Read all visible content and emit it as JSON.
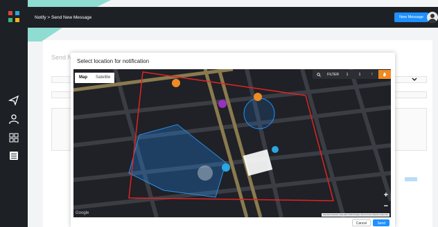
{
  "header": {
    "breadcrumb": "Notify > Send New Message",
    "new_message_label": "New Message"
  },
  "page": {
    "title": "Send New Message"
  },
  "modal": {
    "title": "Select location for notification",
    "map_type_tabs": [
      "Map",
      "Satellite"
    ],
    "toolbar": {
      "filter_label": "FILTER",
      "values": [
        "1",
        "1"
      ]
    },
    "zoom": {
      "in": "+",
      "out": "−"
    },
    "google_label": "Google",
    "attribution": "Keyboard shortcuts | Map data ©2023 Google | Terms of Use | Report a map error",
    "actions": {
      "cancel": "Cancel",
      "send": "Send"
    }
  },
  "colors": {
    "accent": "#1e90ff",
    "dark": "#1d2126",
    "teal": "#8fdcd2",
    "marker_orange": "#f08a24",
    "marker_purple": "#9b2fbf",
    "region": "#e02424"
  }
}
